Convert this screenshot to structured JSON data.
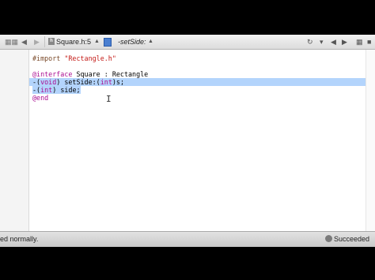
{
  "jumpbar": {
    "file_name": "Square.h:5",
    "method_name": "-setSide:",
    "chevron": "⬍"
  },
  "editor": {
    "lines": [
      "",
      "#import \"Rectangle.h\"",
      "",
      "@interface Square : Rectangle",
      "-(void) setSide:(int)s;",
      "-(int) side;",
      "@end"
    ],
    "selected_lines": [
      4,
      5
    ]
  },
  "status": {
    "message": "ed normally.",
    "build_result": "Succeeded"
  }
}
